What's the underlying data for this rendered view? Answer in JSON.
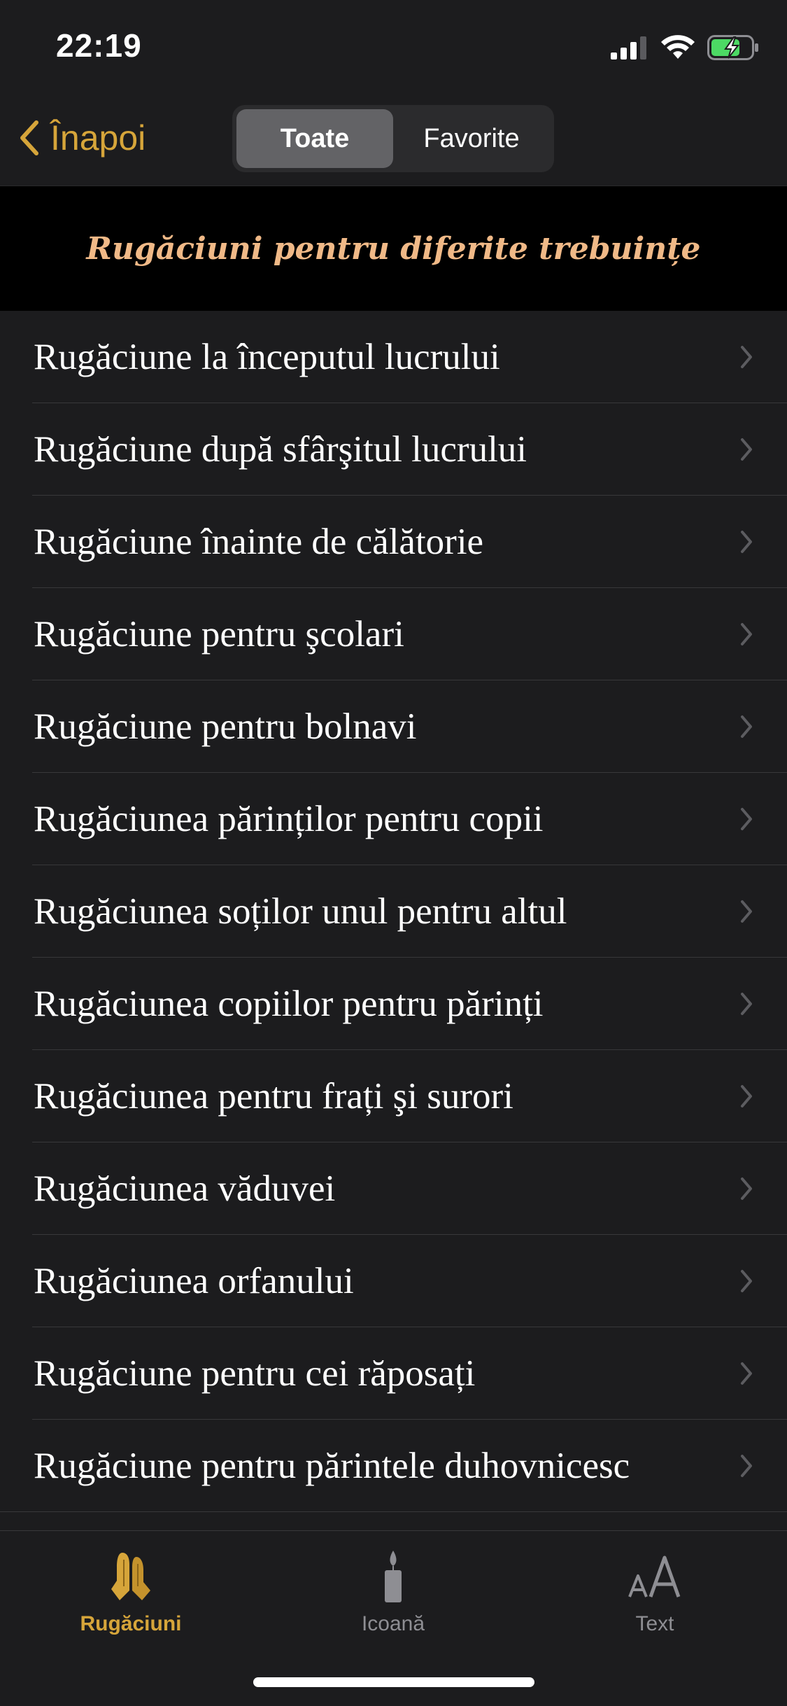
{
  "status_bar": {
    "time": "22:19"
  },
  "nav": {
    "back_label": "Înapoi",
    "segments": [
      "Toate",
      "Favorite"
    ],
    "active_segment": "Toate"
  },
  "header": {
    "title": "Rugăciuni pentru diferite trebuințe"
  },
  "list": {
    "items": [
      "Rugăciune la începutul lucrului",
      "Rugăciune după sfârşitul lucrului",
      "Rugăciune înainte de călătorie",
      "Rugăciune pentru şcolari",
      "Rugăciune pentru bolnavi",
      "Rugăciunea părinților pentru copii",
      "Rugăciunea soților unul pentru altul",
      "Rugăciunea copiilor pentru părinți",
      "Rugăciunea pentru frați şi surori",
      "Rugăciunea văduvei",
      "Rugăciunea orfanului",
      "Rugăciune pentru cei răposați",
      "Rugăciune pentru părintele duhovnicesc"
    ]
  },
  "tab_bar": {
    "tabs": [
      {
        "label": "Rugăciuni",
        "icon": "praying-hands-icon",
        "active": true
      },
      {
        "label": "Icoană",
        "icon": "candle-icon",
        "active": false
      },
      {
        "label": "Text",
        "icon": "text-size-icon",
        "active": false
      }
    ]
  },
  "colors": {
    "accent": "#d6a53a",
    "header_title": "#f0b987",
    "background": "#1c1c1e",
    "header_background": "#000000"
  }
}
